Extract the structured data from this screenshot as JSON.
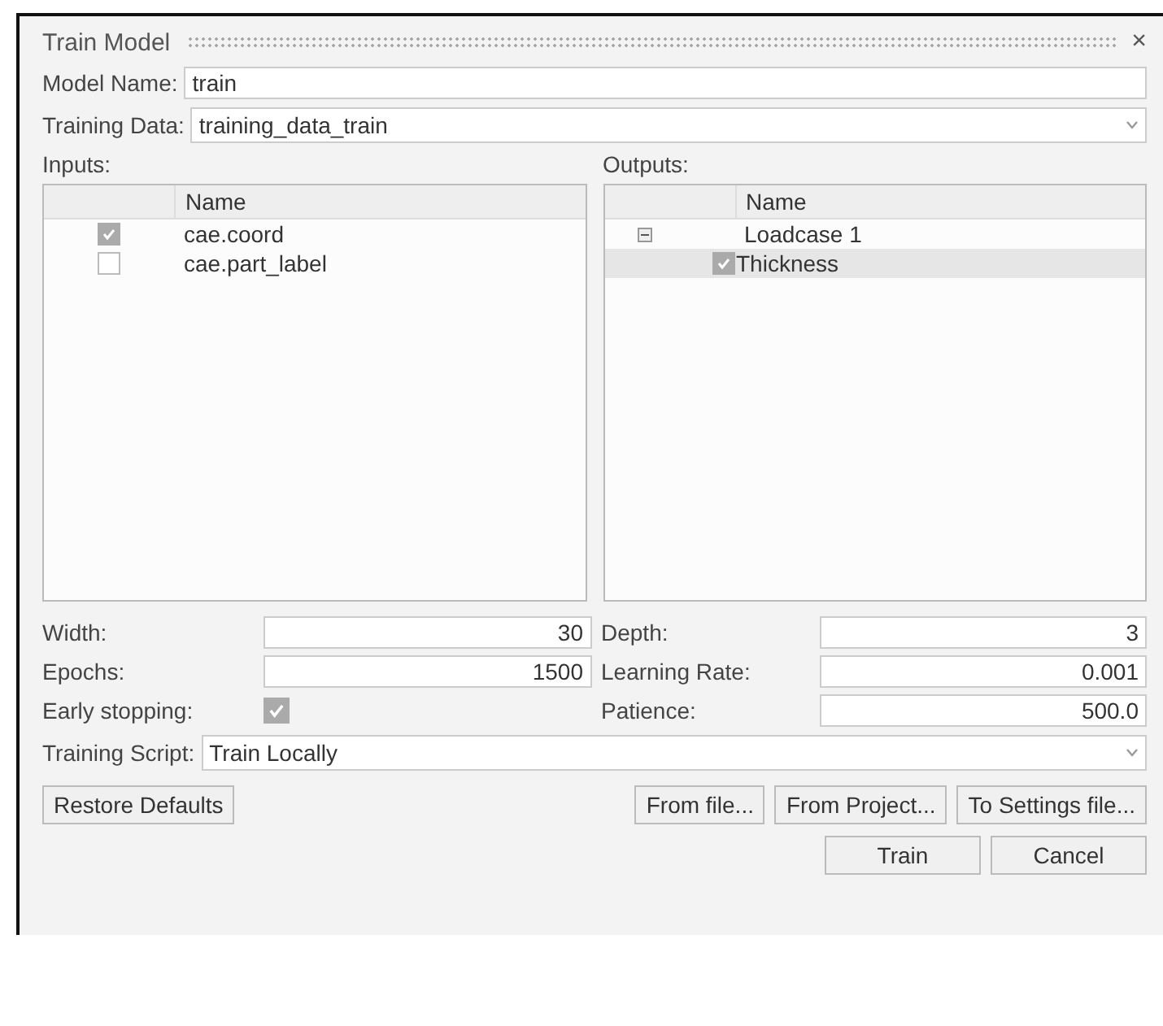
{
  "window": {
    "title": "Train Model",
    "close": "×"
  },
  "model_name": {
    "label": "Model Name:",
    "value": "train"
  },
  "training_data": {
    "label": "Training Data:",
    "value": "training_data_train"
  },
  "inputs": {
    "label": "Inputs:",
    "column": "Name",
    "rows": [
      {
        "name": "cae.coord",
        "checked": true
      },
      {
        "name": "cae.part_label",
        "checked": false
      }
    ]
  },
  "outputs": {
    "label": "Outputs:",
    "column": "Name",
    "tree": [
      {
        "name": "Loadcase 1",
        "expanded": true,
        "children": [
          {
            "name": "Thickness",
            "checked": true,
            "selected": true
          }
        ]
      }
    ]
  },
  "params": [
    {
      "label": "Width:",
      "value": "30"
    },
    {
      "label": "Depth:",
      "value": "3"
    },
    {
      "label": "Epochs:",
      "value": "1500"
    },
    {
      "label": "Learning Rate:",
      "value": "0.001"
    }
  ],
  "early_stopping": {
    "label": "Early stopping:",
    "checked": true
  },
  "patience": {
    "label": "Patience:",
    "value": "500.0"
  },
  "training_script": {
    "label": "Training Script:",
    "value": "Train Locally"
  },
  "buttons": {
    "left": [
      "Restore Defaults"
    ],
    "right": [
      "From file...",
      "From Project...",
      "To Settings file..."
    ],
    "bottom": [
      "Train",
      "Cancel"
    ]
  }
}
